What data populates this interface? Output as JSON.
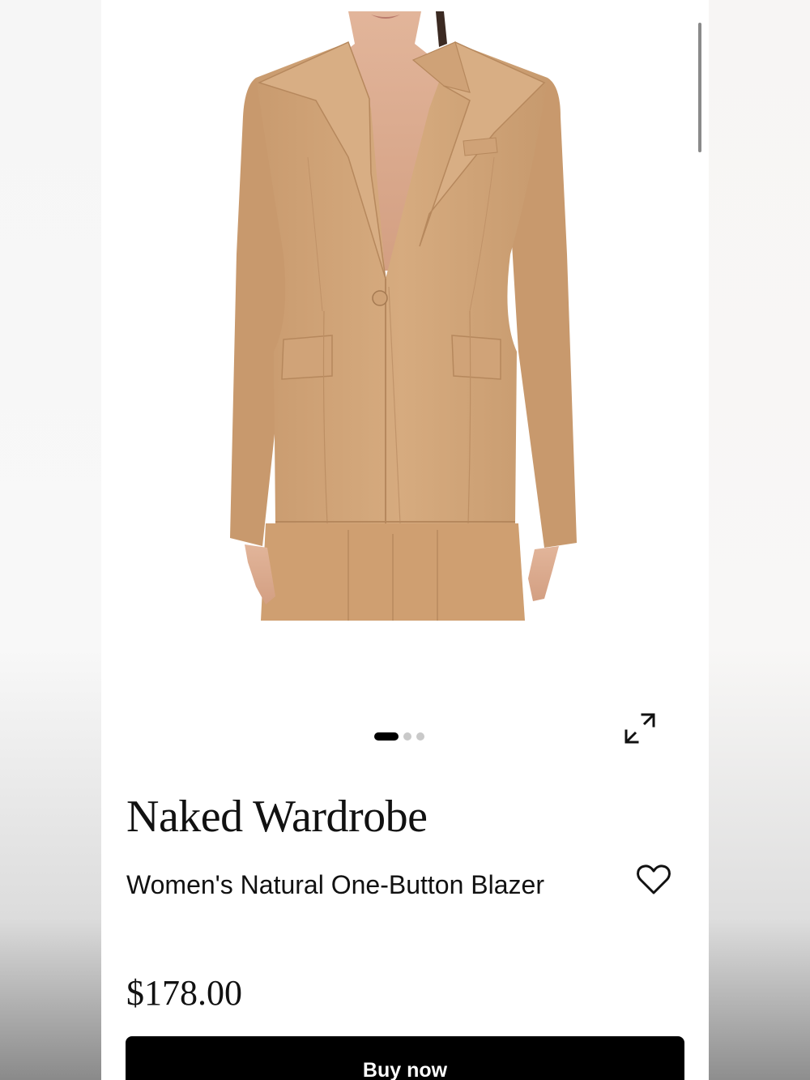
{
  "product": {
    "image": {
      "alt": "Tan one-button blazer with matching trousers on model"
    },
    "gallery": {
      "total": 3,
      "active_index": 0
    },
    "brand": "Naked Wardrobe",
    "name": "Women's Natural One-Button Blazer",
    "price": "$178.00",
    "buy_label": "Buy now"
  },
  "icons": {
    "expand": "expand-arrows-icon",
    "favorite": "heart-outline-icon"
  },
  "colors": {
    "blazer": "#d2a679",
    "button_bg": "#000000",
    "button_text": "#ffffff",
    "dot_active": "#000000",
    "dot_inactive": "#c9c9c9"
  }
}
